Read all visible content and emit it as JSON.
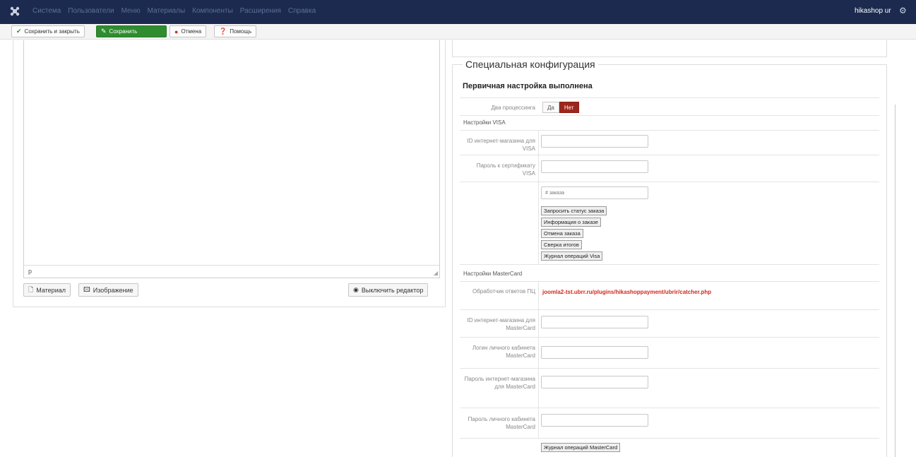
{
  "navbar": {
    "menu": [
      "Система",
      "Пользователи",
      "Меню",
      "Материалы",
      "Компоненты",
      "Расширения",
      "Справка"
    ],
    "user": "hikashop ur",
    "icons": {
      "logo": "joomla-logo-icon",
      "gear": "gear-icon"
    }
  },
  "toolbar": {
    "save_close": "Сохранить и закрыть",
    "save": "Сохранить",
    "cancel": "Отмена",
    "help": "Помощь"
  },
  "editor": {
    "path": "p",
    "article_button": "Материал",
    "image_button": "Изображение",
    "toggle_button": "Выключить редактор"
  },
  "config": {
    "legend": "Специальная конфигурация",
    "status_title": "Первичная настройка выполнена",
    "processing_label": "Два процессинга",
    "processing_yes": "Да",
    "processing_no": "Нет",
    "processing_selected": "Нет",
    "visa": {
      "heading": "Настройки VISA",
      "shop_id_label": "ID интернет-магазина для VISA",
      "shop_id_value": "",
      "cert_password_label": "Пароль к сертификату VISA",
      "cert_password_value": "",
      "order_placeholder": "# заказа",
      "buttons": [
        "Запросить статус заказа",
        "Информация о заказе",
        "Отмена заказа",
        "Сверка итогов",
        "Журнал операций Visa"
      ]
    },
    "mastercard": {
      "heading": "Настройки MasterCard",
      "handler_label": "Обработчик ответов ПЦ",
      "handler_url": "joomla2-tst.ubrr.ru/plugins/hikashoppayment/ubrir/catcher.php",
      "shop_id_label": "ID интернет-магазина для MasterCard",
      "login_label": "Логин личного кабинета MasterCard",
      "shop_password_label": "Пароль интернет-магазина для MasterCard",
      "cabinet_password_label": "Пароль личного кабинета MasterCard",
      "log_button": "Журнал операций MasterCard"
    }
  },
  "colors": {
    "navbar": "#1b2a4e",
    "save_green": "#2f8c2f",
    "no_active": "#9d261d",
    "handler_url": "#d2281e"
  }
}
